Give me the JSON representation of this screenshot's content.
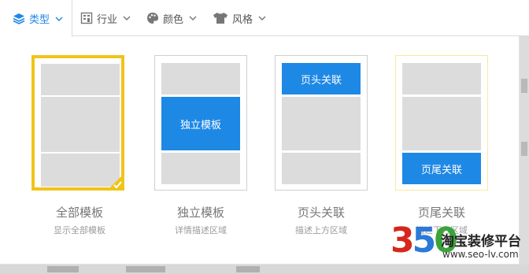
{
  "filter_bar": {
    "tabs": [
      {
        "label": "类型",
        "icon": "layers-icon",
        "active": true
      },
      {
        "label": "行业",
        "icon": "building-icon",
        "active": false
      },
      {
        "label": "颜色",
        "icon": "palette-icon",
        "active": false
      },
      {
        "label": "风格",
        "icon": "shirt-icon",
        "active": false
      }
    ]
  },
  "popup": {
    "cards": [
      {
        "title": "全部模板",
        "subtitle": "显示全部模板",
        "block_label": "",
        "selected": true
      },
      {
        "title": "独立模板",
        "subtitle": "详情描述区域",
        "block_label": "独立模板",
        "selected": false
      },
      {
        "title": "页头关联",
        "subtitle": "描述上方区域",
        "block_label": "页头关联",
        "selected": false
      },
      {
        "title": "页尾关联",
        "subtitle": "描述下方区域",
        "block_label": "页尾关联",
        "selected": false
      }
    ]
  },
  "watermark": {
    "number": "350",
    "title": "淘宝装修平台",
    "url": "www.seo-lv.com"
  },
  "colors": {
    "accent": "#1f87e8",
    "selected_border": "#f0c419",
    "block_gray": "#dcdcdc",
    "block_blue": "#1e88e5"
  }
}
